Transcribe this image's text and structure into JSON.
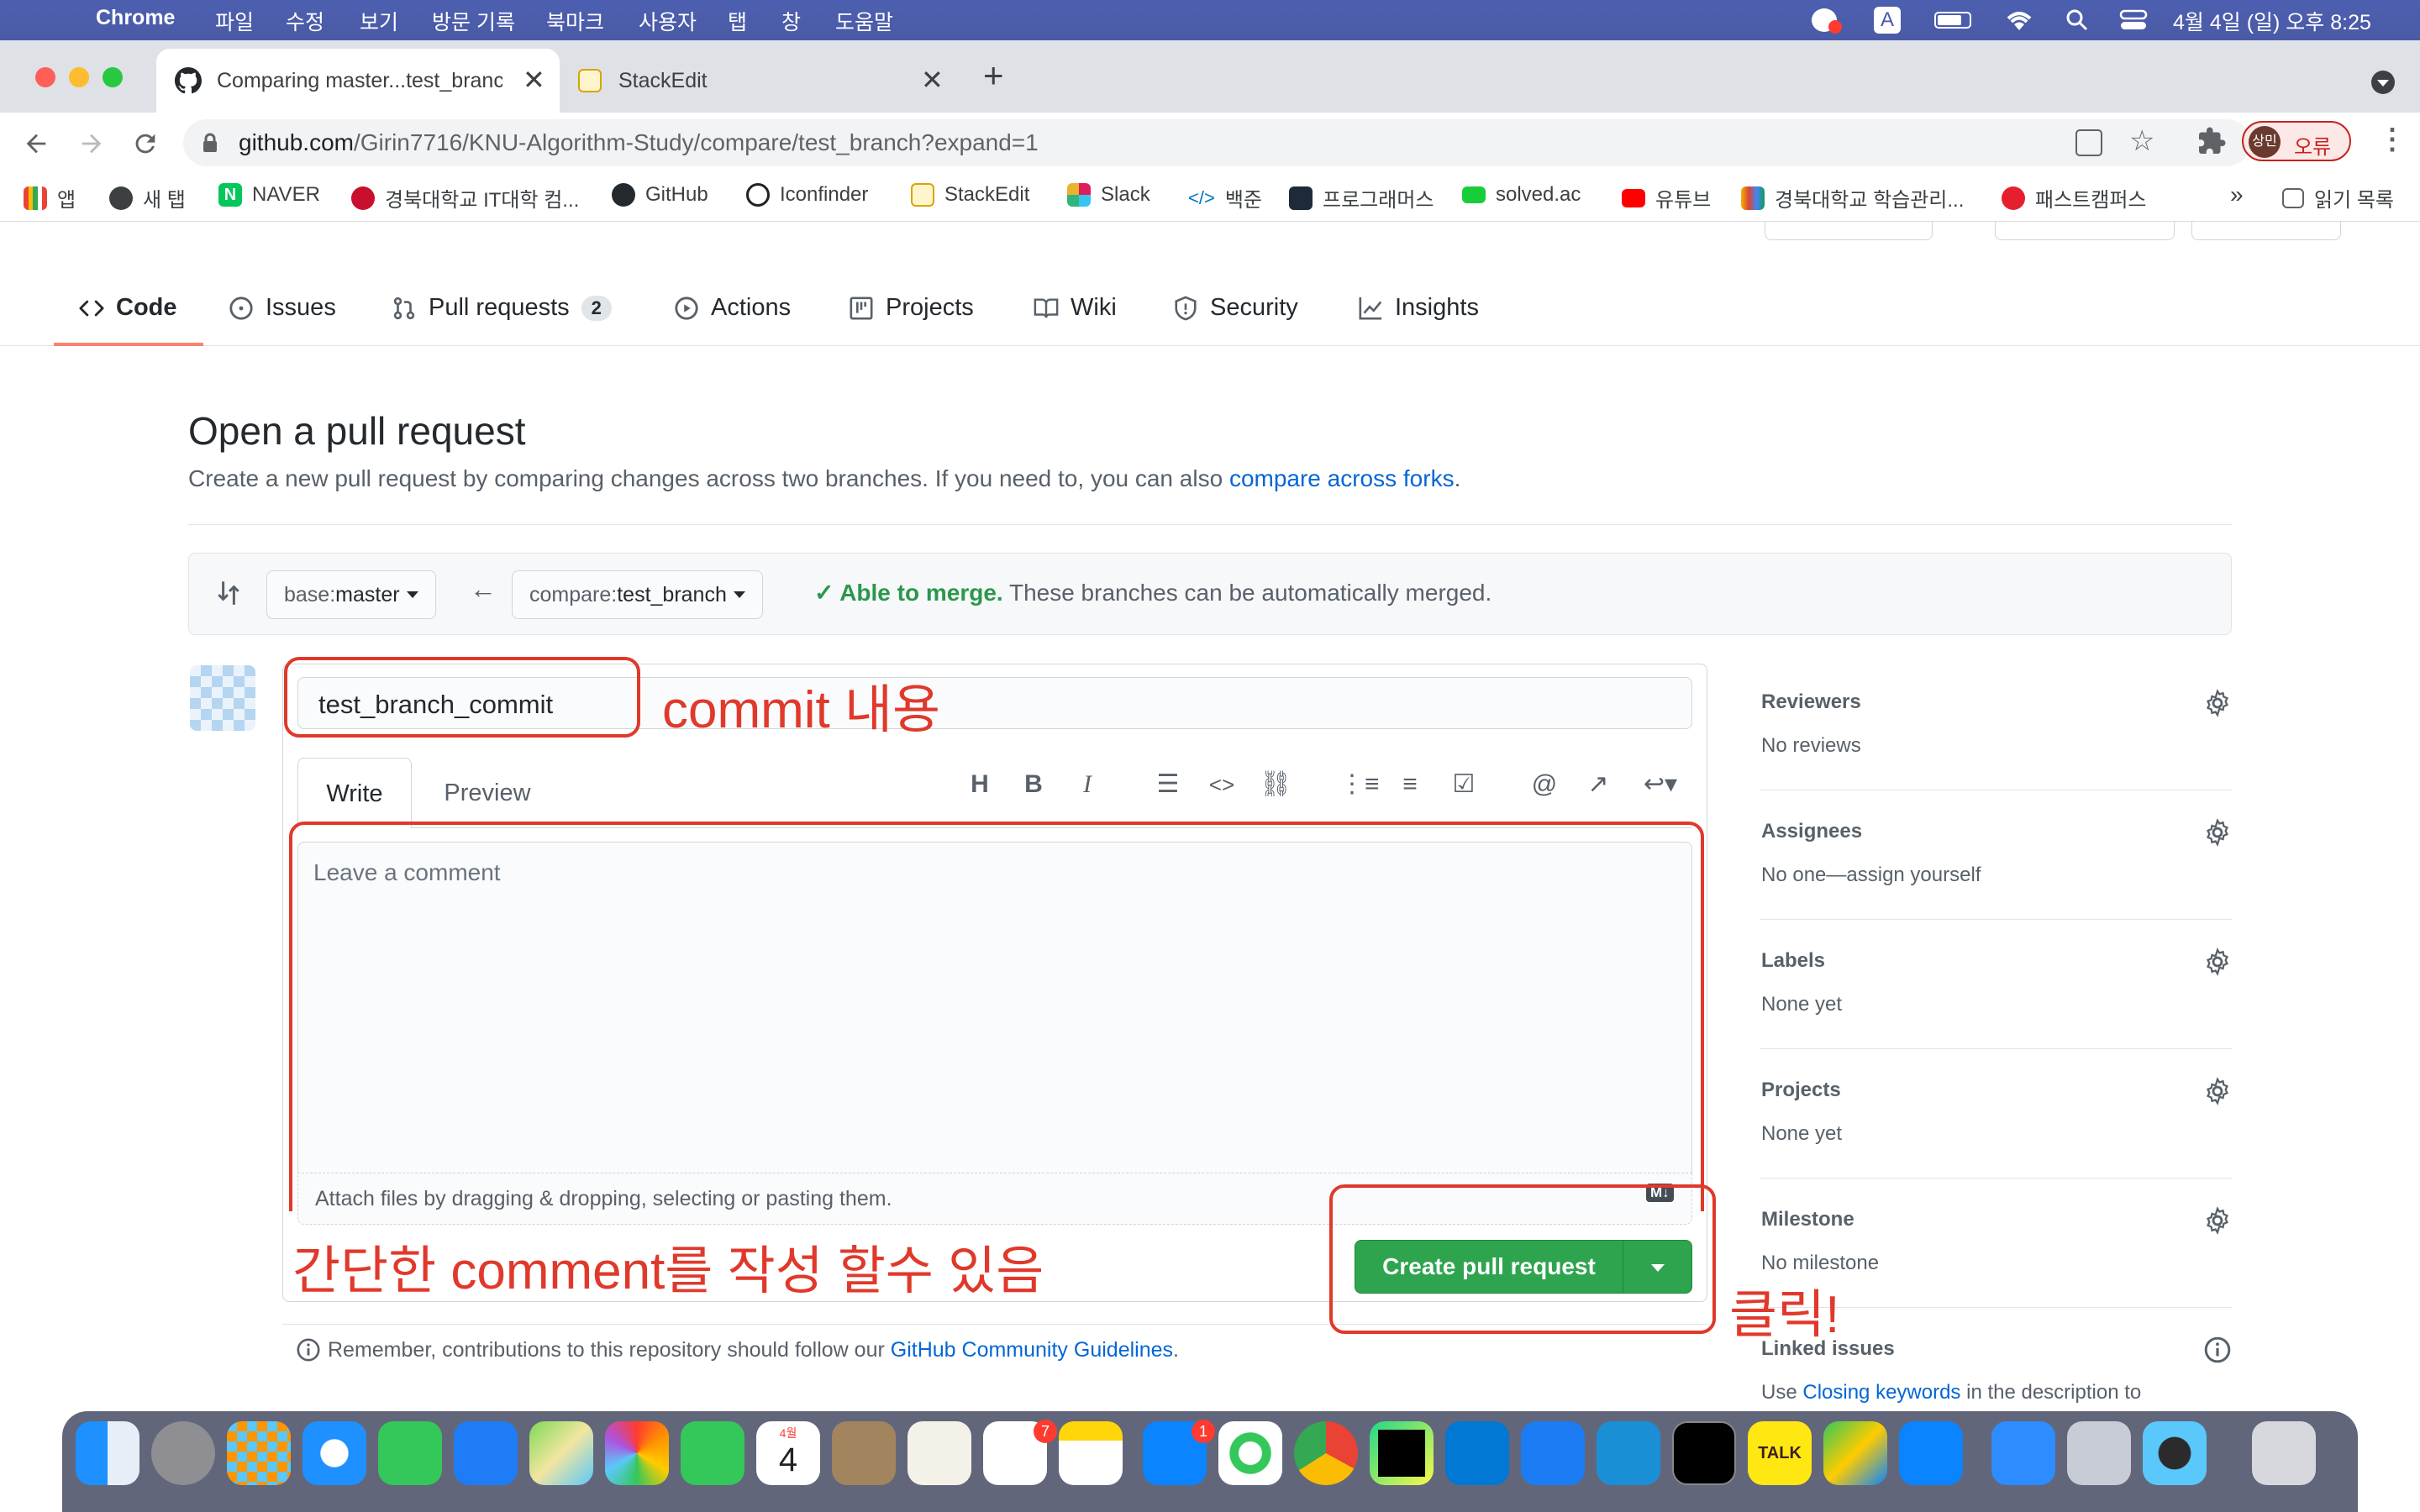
{
  "menubar": {
    "app_name": "Chrome",
    "menus": [
      "파일",
      "수정",
      "보기",
      "방문 기록",
      "북마크",
      "사용자",
      "탭",
      "창",
      "도움말"
    ],
    "clock": "4월 4일 (일) 오후 8:25",
    "input_indicator": "A"
  },
  "browser": {
    "tabs": [
      {
        "title": "Comparing master...test_branc",
        "active": true
      },
      {
        "title": "StackEdit",
        "active": false
      }
    ],
    "url_host": "github.com",
    "url_path": "/Girin7716/KNU-Algorithm-Study/compare/test_branch?expand=1",
    "profile_initials": "상민",
    "profile_status": "오류",
    "bookmarks": [
      "앱",
      "새 탭",
      "NAVER",
      "경북대학교 IT대학 컴...",
      "GitHub",
      "Iconfinder",
      "StackEdit",
      "Slack",
      "백준",
      "프로그래머스",
      "solved.ac",
      "유튜브",
      "경북대학교 학습관리...",
      "패스트캠퍼스"
    ],
    "more_bookmarks": "»",
    "reading_list": "읽기 목록"
  },
  "repo_nav": {
    "tabs": [
      {
        "label": "Code",
        "active": true
      },
      {
        "label": "Issues"
      },
      {
        "label": "Pull requests",
        "count": "2"
      },
      {
        "label": "Actions"
      },
      {
        "label": "Projects"
      },
      {
        "label": "Wiki"
      },
      {
        "label": "Security"
      },
      {
        "label": "Insights"
      }
    ]
  },
  "compare": {
    "title": "Open a pull request",
    "description": "Create a new pull request by comparing changes across two branches. If you need to, you can also ",
    "forks_link": "compare across forks",
    "period": ".",
    "base_prefix": "base: ",
    "base_value": "master",
    "compare_prefix": "compare: ",
    "compare_value": "test_branch",
    "merge_status": "Able to merge.",
    "merge_detail": " These branches can be automatically merged."
  },
  "form": {
    "title_value": "test_branch_commit",
    "tab_write": "Write",
    "tab_preview": "Preview",
    "comment_placeholder": "Leave a comment",
    "attach_hint": "Attach files by dragging & dropping, selecting or pasting them.",
    "md_badge": "M↓",
    "submit_label": "Create pull request",
    "guidelines_prefix": "Remember, contributions to this repository should follow our ",
    "guidelines_link": "GitHub Community Guidelines",
    "guidelines_suffix": "."
  },
  "annotations": {
    "commit_note": "commit 내용",
    "comment_note": "간단한 comment를 작성 할수 있음",
    "click_note": "클릭!",
    "color": "#e0392b"
  },
  "sidebar": {
    "sections": [
      {
        "heading": "Reviewers",
        "value": "No reviews"
      },
      {
        "heading": "Assignees",
        "value": "No one—assign yourself"
      },
      {
        "heading": "Labels",
        "value": "None yet"
      },
      {
        "heading": "Projects",
        "value": "None yet"
      },
      {
        "heading": "Milestone",
        "value": "No milestone"
      }
    ],
    "linked_heading": "Linked issues",
    "linked_prefix": "Use ",
    "linked_link": "Closing keywords",
    "linked_suffix": " in the description to"
  },
  "colors": {
    "link": "#0366d6",
    "success": "#2c974b",
    "button_green": "#2ea44f",
    "active_tab_underline": "#f9826c",
    "annotation": "#e0392b"
  },
  "dock": {
    "badges": {
      "reminders": "7",
      "appstore": "1"
    },
    "calendar_month": "4월",
    "calendar_day": "4",
    "kakao_label": "TALK"
  }
}
